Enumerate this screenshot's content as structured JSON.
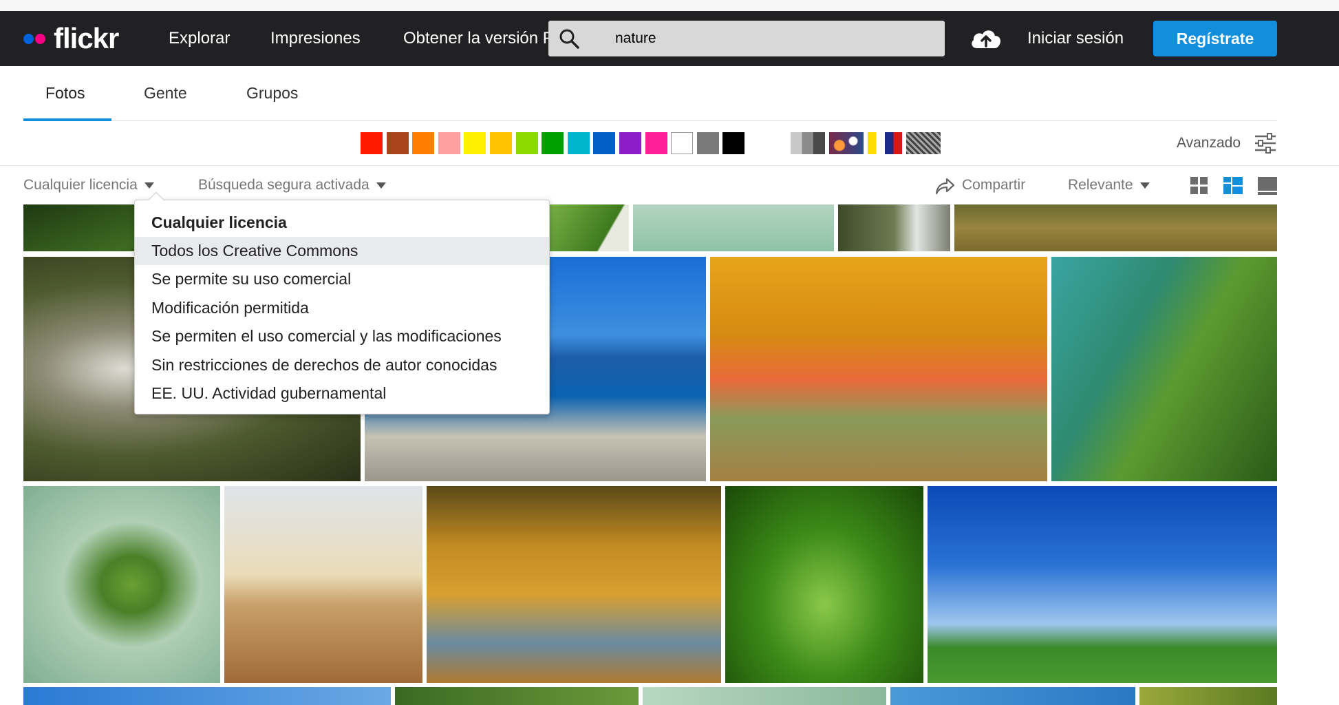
{
  "header": {
    "logo_text": "flickr",
    "nav": [
      "Explorar",
      "Impresiones",
      "Obtener la versión P"
    ],
    "search_value": "nature",
    "signin_label": "Iniciar sesión",
    "signup_label": "Regístrate"
  },
  "tabs": [
    {
      "label": "Fotos",
      "active": true
    },
    {
      "label": "Gente",
      "active": false
    },
    {
      "label": "Grupos",
      "active": false
    }
  ],
  "color_swatches": [
    "#ff1a00",
    "#a8431a",
    "#ff7f00",
    "#ffa0a0",
    "#ffef00",
    "#ffc400",
    "#8cda00",
    "#00a000",
    "#00b4cd",
    "#0060c8",
    "#8c1cc6",
    "#ff1e96",
    "#ffffff",
    "#7a7a7a",
    "#000000"
  ],
  "style_swatches": [
    "black-and-white-icon",
    "shallow-depth-of-field-icon",
    "minimalist-pattern-icon",
    "patterns-icon"
  ],
  "advanced_label": "Avanzado",
  "filters": {
    "license_label": "Cualquier licencia",
    "safesearch_label": "Búsqueda segura activada",
    "share_label": "Compartir",
    "sort_label": "Relevante"
  },
  "license_menu": {
    "items": [
      {
        "label": "Cualquier licencia",
        "selected": true,
        "highlighted": false
      },
      {
        "label": "Todos los Creative Commons",
        "selected": false,
        "highlighted": true
      },
      {
        "label": "Se permite su uso comercial",
        "selected": false,
        "highlighted": false
      },
      {
        "label": "Modificación permitida",
        "selected": false,
        "highlighted": false
      },
      {
        "label": "Se permiten el uso comercial y las modificaciones",
        "selected": false,
        "highlighted": false
      },
      {
        "label": "Sin restricciones de derechos de autor conocidas",
        "selected": false,
        "highlighted": false
      },
      {
        "label": "EE. UU. Actividad gubernamental",
        "selected": false,
        "highlighted": false
      }
    ]
  },
  "photos": [
    "forest-canopy",
    "green-leaf-edge",
    "pale-green-leaf",
    "waterfall-moss",
    "autumn-lawn",
    "mossy-waterfall",
    "rocky-blue-coast",
    "autumn-trees-park",
    "leaf-closeup",
    "leaf-on-green",
    "person-on-pier",
    "autumn-reflection",
    "clover-sprout",
    "blue-sky-field",
    "bottom-row-1",
    "bottom-row-2",
    "bottom-row-3",
    "bottom-row-4",
    "bottom-row-5"
  ]
}
